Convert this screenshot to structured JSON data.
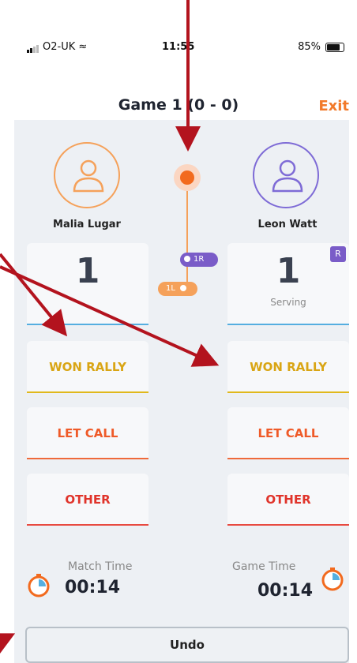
{
  "status": {
    "carrier": "O2-UK",
    "time": "11:55",
    "battery": "85%"
  },
  "header": {
    "title": "Game 1 (0 - 0)",
    "exit_label": "Exit"
  },
  "players": [
    {
      "name": "Malia Lugar",
      "score": "1",
      "color": "#f5a15a"
    },
    {
      "name": "Leon Watt",
      "score": "1",
      "color": "#7e6bd6",
      "serving_label": "Serving",
      "badge": "R"
    }
  ],
  "rally_chips": {
    "right": "1R",
    "left": "1L"
  },
  "buttons": {
    "won_rally": "WON RALLY",
    "let_call": "LET CALL",
    "other": "OTHER"
  },
  "timers": {
    "match_label": "Match Time",
    "match_value": "00:14",
    "game_label": "Game Time",
    "game_value": "00:14"
  },
  "undo_label": "Undo",
  "colors": {
    "accent": "#f27a2a",
    "arrow": "#b3131e",
    "won": "#e0b81c",
    "let": "#ef6a3a",
    "other": "#e84a40",
    "score_line": "#55aee0"
  }
}
